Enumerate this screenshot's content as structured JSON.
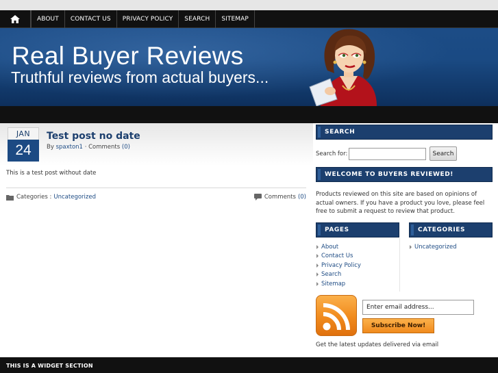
{
  "nav": {
    "home_icon": "home-icon",
    "items": [
      "ABOUT",
      "CONTACT US",
      "PRIVACY POLICY",
      "SEARCH",
      "SITEMAP"
    ]
  },
  "header": {
    "title": "Real Buyer Reviews",
    "tagline": "Truthful reviews from actual buyers..."
  },
  "post": {
    "date_month": "JAN",
    "date_day": "24",
    "title": "Test post no date",
    "meta_by": "By",
    "author": "spaxton1",
    "meta_sep": "·",
    "comments_label": "Comments",
    "comments_count": "(0)",
    "body": "This is a test post without date",
    "categories_label": "Categories :",
    "category": "Uncategorized",
    "footer_comments_label": "Comments",
    "footer_comments_count": "(0)"
  },
  "sidebar": {
    "search_title": "SEARCH",
    "search_label": "Search for:",
    "search_value": "",
    "search_button": "Search",
    "welcome_title": "WELCOME TO BUYERS REVIEWED!",
    "welcome_text": "Products reviewed on this site are based on opinions of actual owners. If you have a product you love, please feel free to submit a request to review that product.",
    "pages_title": "PAGES",
    "pages": [
      "About",
      "Contact Us",
      "Privacy Policy",
      "Search",
      "Sitemap"
    ],
    "categories_title": "CATEGORIES",
    "categories": [
      "Uncategorized"
    ],
    "email_value": "Enter email address...",
    "subscribe_button": "Subscribe Now!",
    "rss_caption": "Get the latest updates delivered via email"
  },
  "footer": {
    "widget_title": "THIS IS A WIDGET SECTION"
  },
  "colors": {
    "nav_bg": "#111111",
    "header_blue": "#1c4a83",
    "widget_title_bg": "#1c3f6e",
    "link": "#1c4a83",
    "rss_orange": "#f08a1d"
  }
}
